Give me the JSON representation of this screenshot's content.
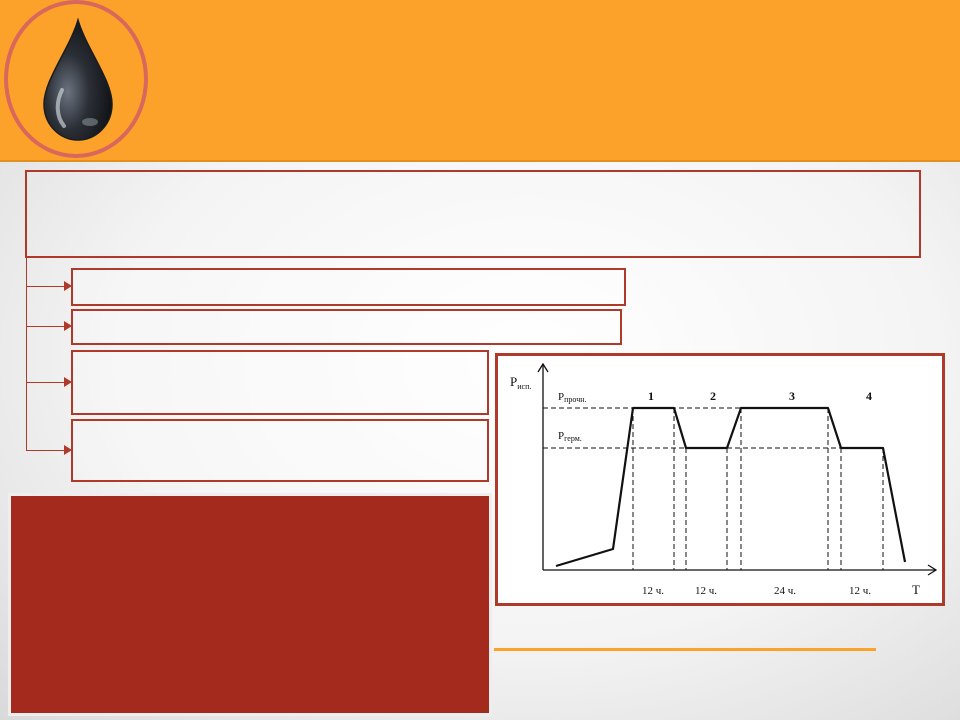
{
  "chart_data": {
    "type": "line",
    "x_axis_label": "T",
    "y_axis_label": {
      "main": "P",
      "sub": "исп."
    },
    "levels": [
      {
        "main": "P",
        "sub": "прочн."
      },
      {
        "main": "P",
        "sub": "герм."
      }
    ],
    "stages": [
      "1",
      "2",
      "3",
      "4"
    ],
    "durations": [
      "12 ч.",
      "12 ч.",
      "24 ч.",
      "12 ч."
    ]
  }
}
